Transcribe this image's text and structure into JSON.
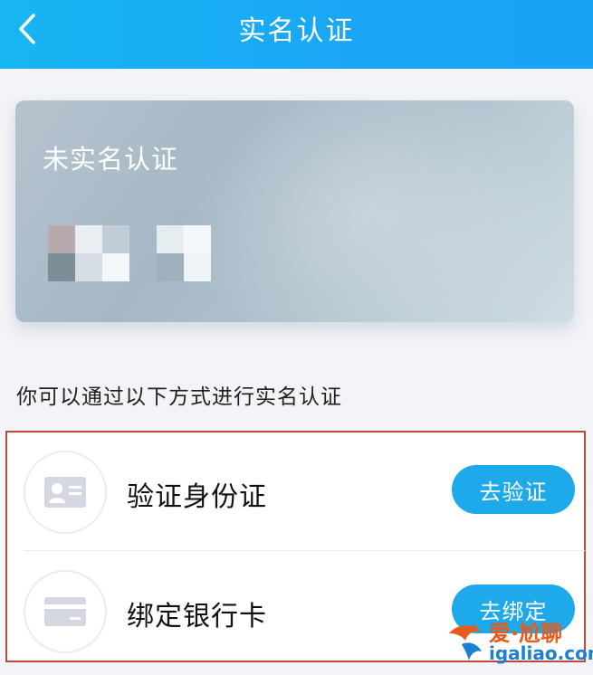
{
  "header": {
    "title": "实名认证",
    "back_icon": "chevron-left-icon"
  },
  "card": {
    "status": "未实名认证"
  },
  "hint": "你可以通过以下方式进行实名认证",
  "options": [
    {
      "label": "验证身份证",
      "action": "去验证",
      "icon": "id-card-icon"
    },
    {
      "label": "绑定银行卡",
      "action": "去绑定",
      "icon": "bank-card-icon"
    }
  ],
  "watermark": {
    "line1": "爱·尬聊",
    "line2": "igaliao.com"
  },
  "colors": {
    "header": "#1aa6f5",
    "button": "#1da9ea",
    "highlight_border": "#b94a3c"
  }
}
